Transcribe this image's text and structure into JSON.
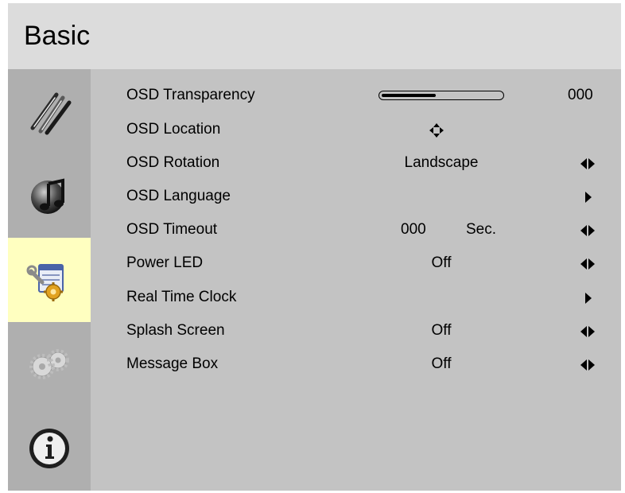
{
  "header": {
    "title": "Basic"
  },
  "sidebar": {
    "items": [
      {
        "name": "tools",
        "icon": "pens-icon",
        "active": false
      },
      {
        "name": "audio",
        "icon": "music-note-icon",
        "active": false
      },
      {
        "name": "basic-settings",
        "icon": "settings-window-icon",
        "active": true
      },
      {
        "name": "advanced",
        "icon": "gears-icon",
        "active": false
      },
      {
        "name": "information",
        "icon": "info-icon",
        "active": false
      }
    ]
  },
  "menu": {
    "transparency": {
      "label": "OSD Transparency",
      "value": "000",
      "slider_fraction": 0.45
    },
    "location": {
      "label": "OSD Location",
      "control_icon": "four-way-arrow-icon"
    },
    "rotation": {
      "label": "OSD Rotation",
      "value": "Landscape",
      "control_icon": "left-right-arrow-icon"
    },
    "language": {
      "label": "OSD Language",
      "control_icon": "right-arrow-icon"
    },
    "timeout": {
      "label": "OSD Timeout",
      "value": "000",
      "unit": "Sec.",
      "control_icon": "left-right-arrow-icon"
    },
    "power_led": {
      "label": "Power LED",
      "value": "Off",
      "control_icon": "left-right-arrow-icon"
    },
    "rtc": {
      "label": "Real Time Clock",
      "control_icon": "right-arrow-icon"
    },
    "splash": {
      "label": "Splash Screen",
      "value": "Off",
      "control_icon": "left-right-arrow-icon"
    },
    "message_box": {
      "label": "Message Box",
      "value": "Off",
      "control_icon": "left-right-arrow-icon"
    }
  },
  "colors": {
    "panel_bg": "#c3c3c3",
    "header_bg": "#dcdcdc",
    "sidebar_bg": "#afafaf",
    "active_highlight": "#ffffc0"
  }
}
